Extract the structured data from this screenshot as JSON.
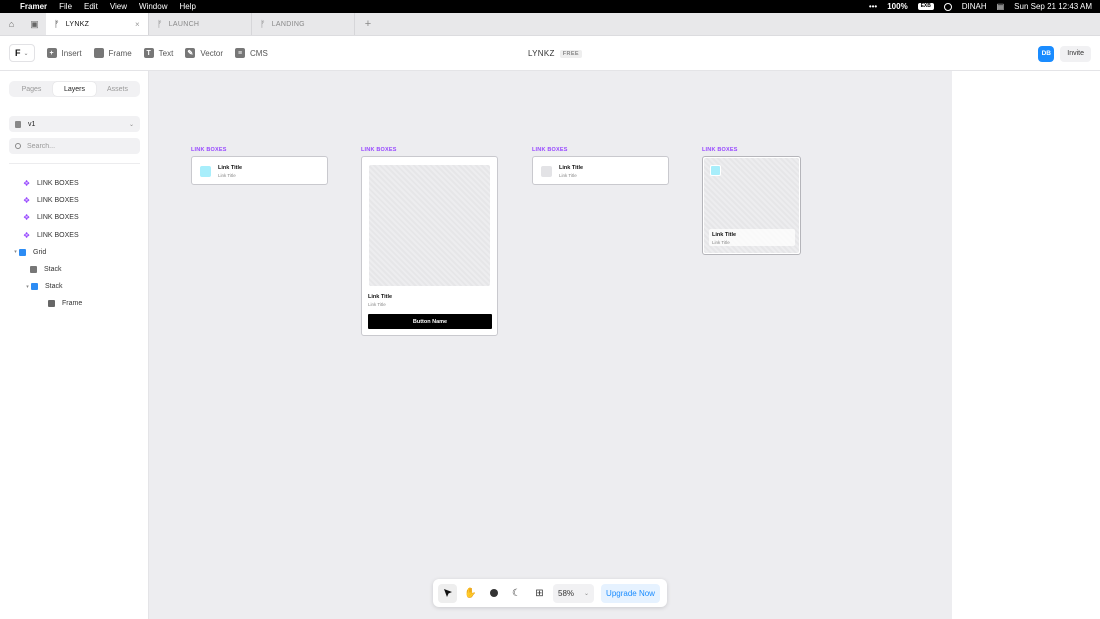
{
  "menubar": {
    "app_name": "Framer",
    "menus": [
      "File",
      "Edit",
      "View",
      "Window",
      "Help"
    ],
    "status": {
      "more": "•••",
      "battery_percent": "100%",
      "battery_icon_text": "EXB",
      "user": "DINAH",
      "datetime": "Sun Sep 21  12:43 AM"
    }
  },
  "tabs": [
    {
      "label": "LYNKZ",
      "active": true,
      "close": "×"
    },
    {
      "label": "LAUNCH",
      "active": false
    },
    {
      "label": "LANDING",
      "active": false
    }
  ],
  "tab_add": "+",
  "toolbar": {
    "logo_glyph": "F",
    "tools": [
      {
        "label": "Insert",
        "icon": "plus-icon",
        "glyph": "+"
      },
      {
        "label": "Frame",
        "icon": "frame-icon",
        "glyph": ""
      },
      {
        "label": "Text",
        "icon": "text-icon",
        "glyph": "T"
      },
      {
        "label": "Vector",
        "icon": "pen-icon",
        "glyph": "✎"
      },
      {
        "label": "CMS",
        "icon": "database-icon",
        "glyph": "≡"
      }
    ],
    "project_name": "LYNKZ",
    "plan_badge": "FREE",
    "avatar_initials": "DB",
    "invite_label": "Invite"
  },
  "sidebar": {
    "segments": [
      "Pages",
      "Layers",
      "Assets"
    ],
    "active_segment": "Layers",
    "page_selector": "v1",
    "search_placeholder": "Search...",
    "layers": [
      {
        "label": "LINK BOXES",
        "type": "component",
        "indent": 0
      },
      {
        "label": "LINK BOXES",
        "type": "component",
        "indent": 0
      },
      {
        "label": "LINK BOXES",
        "type": "component",
        "indent": 0
      },
      {
        "label": "LINK BOXES",
        "type": "component",
        "indent": 0
      },
      {
        "label": "Grid",
        "type": "grid",
        "indent": 0,
        "expanded": true
      },
      {
        "label": "Stack",
        "type": "stack",
        "indent": 1
      },
      {
        "label": "Stack",
        "type": "stack",
        "indent": 1,
        "expanded": true
      },
      {
        "label": "Frame",
        "type": "frame",
        "indent": 2
      }
    ]
  },
  "canvas": {
    "components": [
      {
        "label": "LINK BOXES",
        "title": "Link Title",
        "subtitle": "Link Title"
      },
      {
        "label": "LINK BOXES",
        "title": "Link Title",
        "subtitle": "Link Title",
        "button": "Button Name"
      },
      {
        "label": "LINK BOXES",
        "title": "Link Title",
        "subtitle": "Link Title"
      },
      {
        "label": "LINK BOXES",
        "title": "Link Title",
        "subtitle": "Link Title"
      }
    ]
  },
  "bottombar": {
    "tools": [
      "cursor-icon",
      "hand-icon",
      "comment-icon",
      "moon-icon",
      "grid-icon"
    ],
    "zoom": "58%",
    "upgrade_label": "Upgrade Now"
  },
  "colors": {
    "accent": "#1a8cff",
    "component_purple": "#9747ff",
    "canvas_bg": "#ededf0",
    "swatch_cyan": "#a8eefb"
  }
}
